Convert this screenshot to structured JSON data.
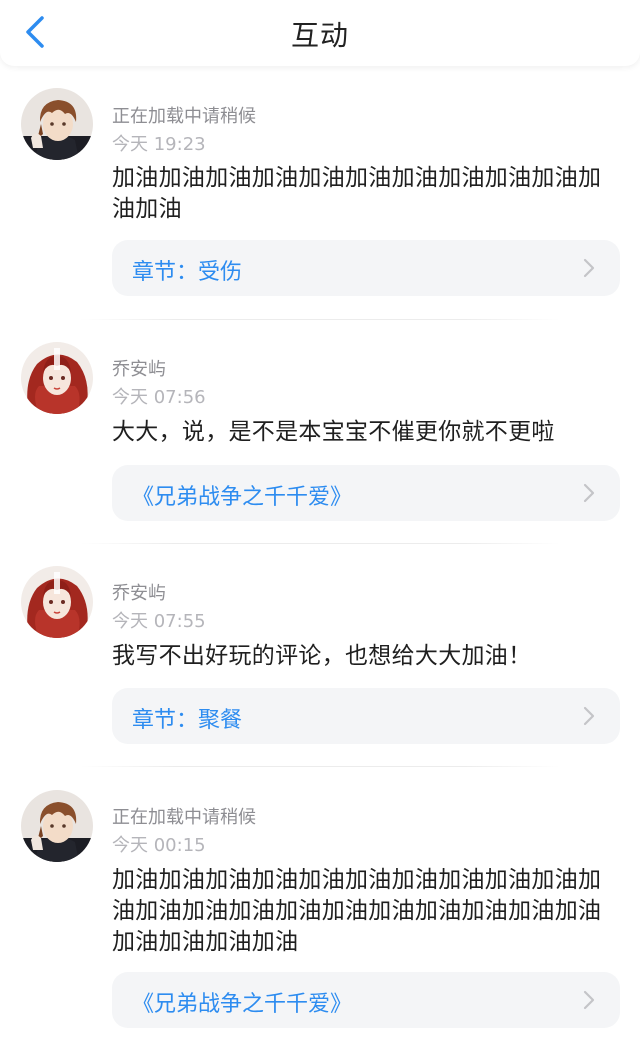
{
  "header": {
    "title": "互动",
    "back_icon": "chevron-left-icon",
    "accent": "#2d8cf0"
  },
  "comments": [
    {
      "username": "正在加载中请稍候",
      "time": "今天 19:23",
      "text": "加油加油加油加油加油加油加油加油加油加油加油加油",
      "ref_label": "章节：受伤",
      "avatar": "avatar-boy"
    },
    {
      "username": "乔安屿",
      "time": "今天 07:56",
      "text": "大大，说，是不是本宝宝不催更你就不更啦",
      "ref_label": "《兄弟战争之千千爱》",
      "avatar": "avatar-girl"
    },
    {
      "username": "乔安屿",
      "time": "今天 07:55",
      "text": "我写不出好玩的评论，也想给大大加油！",
      "ref_label": "章节：聚餐",
      "avatar": "avatar-girl"
    },
    {
      "username": "正在加载中请稍候",
      "time": "今天 00:15",
      "text": "加油加油加油加油加油加油加油加油加油加油加油加油加油加油加油加油加油加油加油加油加油加油加油加油加油",
      "ref_label": "《兄弟战争之千千爱》",
      "avatar": "avatar-boy"
    }
  ]
}
